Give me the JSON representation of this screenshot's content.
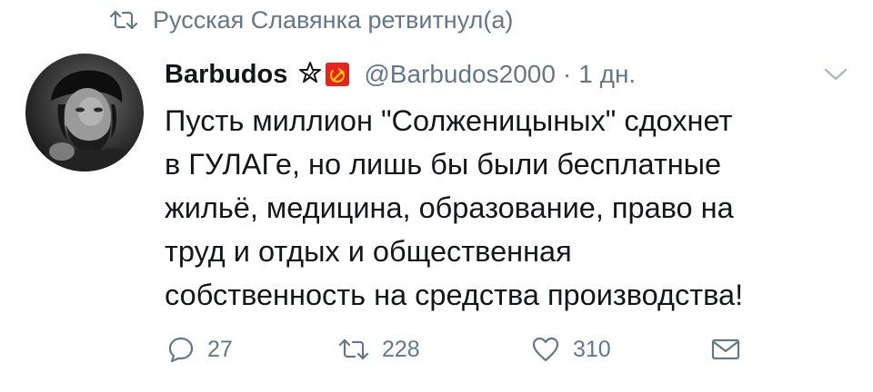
{
  "retweet_context": {
    "icon": "retweet-icon",
    "text": "Русская Славянка ретвитнул(а)"
  },
  "tweet": {
    "avatar_icon": "avatar-photo",
    "display_name": "Barbudos",
    "badges": [
      "star-icon",
      "hammer-sickle-flag-icon"
    ],
    "handle": "@Barbudos2000",
    "separator": "·",
    "time": "1 дн.",
    "menu_icon": "chevron-down-icon",
    "text_lines": [
      "Пусть миллион \"Солженицыных\" сдохнет",
      "в ГУЛАГе, но лишь бы были бесплатные",
      "жильё, медицина, образование, право на",
      "труд и отдых и общественная",
      "собственность на средства производства!"
    ]
  },
  "actions": {
    "reply": {
      "icon": "reply-icon",
      "count": "27"
    },
    "retweet": {
      "icon": "retweet-icon",
      "count": "228"
    },
    "like": {
      "icon": "heart-icon",
      "count": "310"
    },
    "message": {
      "icon": "envelope-icon"
    }
  },
  "colors": {
    "text": "#14171a",
    "secondary": "#657786",
    "flag_red": "#e8231f",
    "flag_yellow": "#ffd000",
    "background": "#ffffff"
  }
}
